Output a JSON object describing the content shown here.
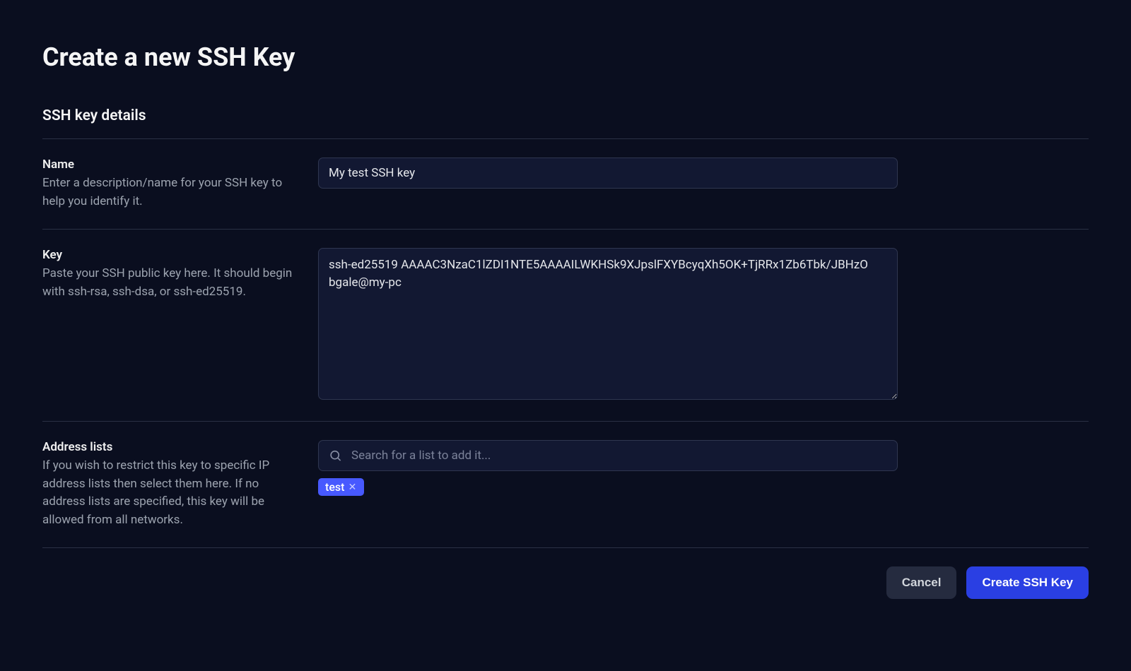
{
  "page": {
    "title": "Create a new SSH Key",
    "section_title": "SSH key details"
  },
  "fields": {
    "name": {
      "label": "Name",
      "help": "Enter a description/name for your SSH key to help you identify it.",
      "value": "My test SSH key"
    },
    "key": {
      "label": "Key",
      "help": "Paste your SSH public key here. It should begin with ssh-rsa, ssh-dsa, or ssh-ed25519.",
      "value": "ssh-ed25519 AAAAC3NzaC1lZDI1NTE5AAAAILWKHSk9XJpslFXYBcyqXh5OK+TjRRx1Zb6Tbk/JBHzO bgale@my-pc"
    },
    "address_lists": {
      "label": "Address lists",
      "help": "If you wish to restrict this key to specific IP address lists then select them here. If no address lists are specified, this key will be allowed from all networks.",
      "search_placeholder": "Search for a list to add it...",
      "selected": [
        "test"
      ]
    }
  },
  "actions": {
    "cancel": "Cancel",
    "submit": "Create SSH Key"
  }
}
